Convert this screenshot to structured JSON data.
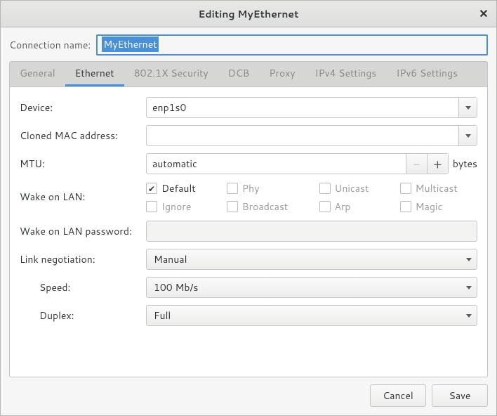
{
  "titlebar": {
    "title": "Editing MyEthernet"
  },
  "connection_name": {
    "label": "Connection name:",
    "value": "MyEthernet"
  },
  "tabs": [
    {
      "label": "General"
    },
    {
      "label": "Ethernet"
    },
    {
      "label": "802.1X Security"
    },
    {
      "label": "DCB"
    },
    {
      "label": "Proxy"
    },
    {
      "label": "IPv4 Settings"
    },
    {
      "label": "IPv6 Settings"
    }
  ],
  "active_tab": 1,
  "form": {
    "device": {
      "label": "Device:",
      "value": "enp1s0"
    },
    "cloned_mac": {
      "label": "Cloned MAC address:",
      "value": ""
    },
    "mtu": {
      "label": "MTU:",
      "value": "automatic",
      "unit": "bytes"
    },
    "wol": {
      "label": "Wake on LAN:",
      "options": [
        {
          "label": "Default",
          "checked": true,
          "enabled": true
        },
        {
          "label": "Phy",
          "checked": false,
          "enabled": false
        },
        {
          "label": "Unicast",
          "checked": false,
          "enabled": false
        },
        {
          "label": "Multicast",
          "checked": false,
          "enabled": false
        },
        {
          "label": "Ignore",
          "checked": false,
          "enabled": false
        },
        {
          "label": "Broadcast",
          "checked": false,
          "enabled": false
        },
        {
          "label": "Arp",
          "checked": false,
          "enabled": false
        },
        {
          "label": "Magic",
          "checked": false,
          "enabled": false
        }
      ]
    },
    "wol_password": {
      "label": "Wake on LAN password:"
    },
    "link_negotiation": {
      "label": "Link negotiation:",
      "value": "Manual"
    },
    "speed": {
      "label": "Speed:",
      "value": "100 Mb/s"
    },
    "duplex": {
      "label": "Duplex:",
      "value": "Full"
    }
  },
  "buttons": {
    "cancel": "Cancel",
    "save": "Save"
  }
}
